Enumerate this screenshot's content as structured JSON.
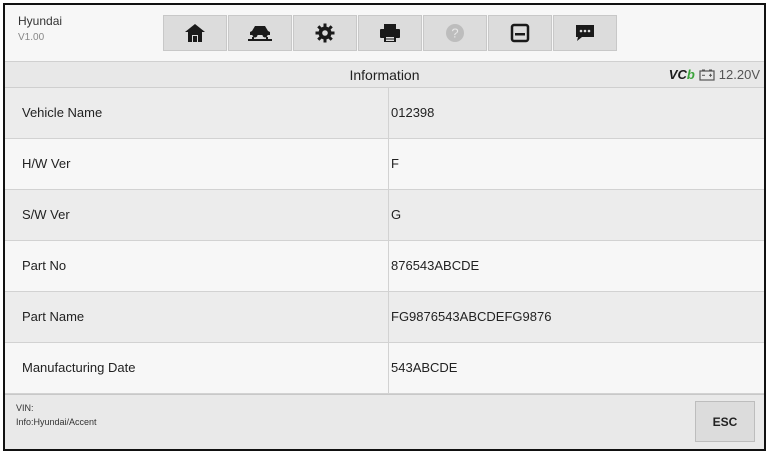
{
  "app": {
    "name": "Hyundai",
    "version": "V1.00"
  },
  "toolbar": {
    "icons": [
      "home-icon",
      "vehicle-lift-icon",
      "settings-gear-icon",
      "printer-icon",
      "help-icon",
      "save-icon",
      "message-icon"
    ]
  },
  "header": {
    "title": "Information",
    "vci_label": "VCI",
    "voltage": "12.20V"
  },
  "table": {
    "rows": [
      {
        "label": "Vehicle Name",
        "value": "012398"
      },
      {
        "label": "H/W Ver",
        "value": "F"
      },
      {
        "label": "S/W Ver",
        "value": "G"
      },
      {
        "label": "Part No",
        "value": "876543ABCDE"
      },
      {
        "label": "Part Name",
        "value": "FG9876543ABCDEFG9876"
      },
      {
        "label": "Manufacturing Date",
        "value": "543ABCDE"
      },
      {
        "label": "",
        "value": ""
      }
    ]
  },
  "footer": {
    "vin": "VIN:",
    "info": "Info:Hyundai/Accent",
    "esc_label": "ESC"
  },
  "colors": {
    "accent_green": "#3aa33a"
  }
}
